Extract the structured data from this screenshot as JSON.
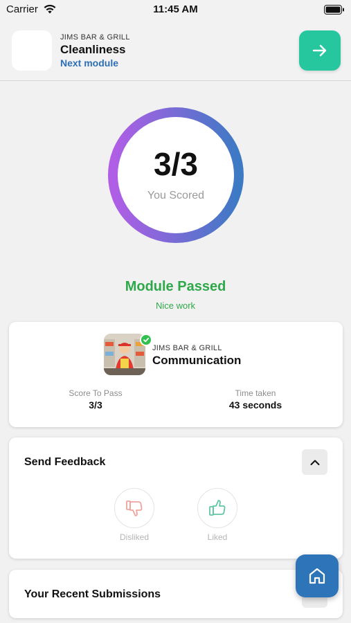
{
  "status_bar": {
    "carrier": "Carrier",
    "time": "11:45 AM"
  },
  "header": {
    "brand": "JIMS BAR & GRILL",
    "title": "Cleanliness",
    "next_link": "Next module",
    "next_button_icon": "arrow-right-icon",
    "accent": "#26c79e"
  },
  "score": {
    "value": "3/3",
    "label": "You Scored",
    "ring_gradient": [
      "#b15ee6",
      "#3c7ac4"
    ]
  },
  "result": {
    "title": "Module Passed",
    "subtitle": "Nice work",
    "color": "#2ea84a"
  },
  "summary": {
    "brand": "JIMS BAR & GRILL",
    "title": "Communication",
    "score_to_pass_label": "Score To Pass",
    "score_to_pass_value": "3/3",
    "time_taken_label": "Time taken",
    "time_taken_value": "43 seconds"
  },
  "feedback": {
    "title": "Send Feedback",
    "collapse_icon": "chevron-up-icon",
    "disliked_label": "Disliked",
    "liked_label": "Liked"
  },
  "recent": {
    "title": "Your Recent Submissions"
  },
  "fab": {
    "icon": "home-icon",
    "color": "#2e74b8"
  }
}
